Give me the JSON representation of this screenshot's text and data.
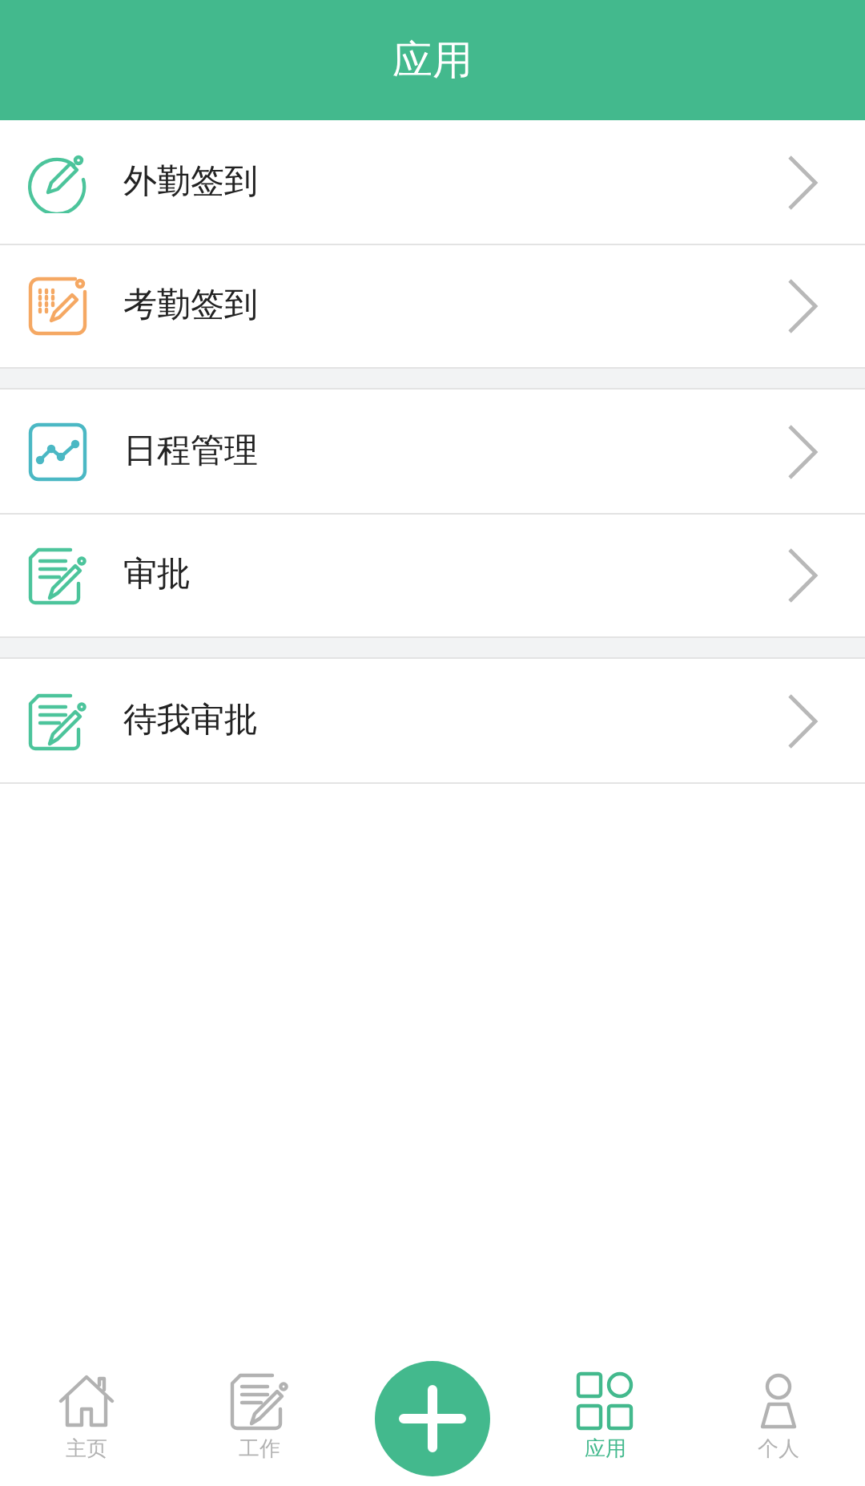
{
  "header": {
    "title": "应用"
  },
  "groups": [
    {
      "items": [
        {
          "label": "外勤签到",
          "kind": "pencil-circle",
          "color": "#4cc49b"
        },
        {
          "label": "考勤签到",
          "kind": "grid-pencil",
          "color": "#f5a863"
        }
      ]
    },
    {
      "items": [
        {
          "label": "日程管理",
          "kind": "chart",
          "color": "#4bb8c4"
        },
        {
          "label": "审批",
          "kind": "document",
          "color": "#4cc49b"
        }
      ]
    },
    {
      "items": [
        {
          "label": "待我审批",
          "kind": "document",
          "color": "#4cc49b"
        }
      ]
    }
  ],
  "tabbar": [
    {
      "kind": "home",
      "label": "主页",
      "selected": false
    },
    {
      "kind": "work",
      "label": "工作",
      "selected": false
    },
    {
      "kind": "add"
    },
    {
      "kind": "apps",
      "label": "应用",
      "selected": true
    },
    {
      "kind": "person",
      "label": "个人",
      "selected": false
    }
  ]
}
